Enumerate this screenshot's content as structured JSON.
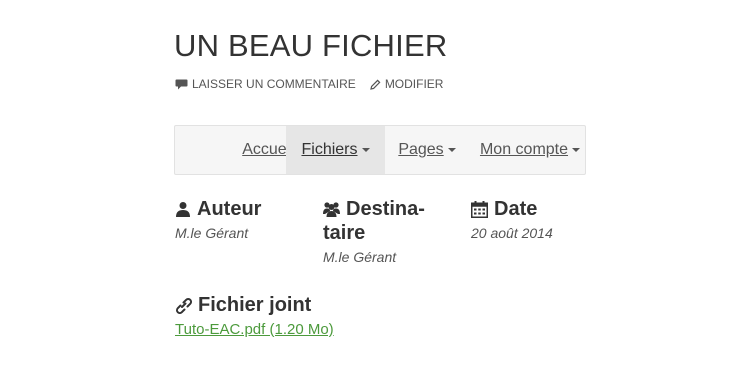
{
  "article": {
    "title": "UN BEAU FICHIER",
    "actions": {
      "comment_label": "LAISSER UN COMMENTAIRE",
      "edit_label": "MODIFIER"
    }
  },
  "nav": {
    "items": [
      {
        "label": "Accueil",
        "dropdown": false,
        "active": false
      },
      {
        "label": "Fichiers",
        "dropdown": true,
        "active": true
      },
      {
        "label": "Pages",
        "dropdown": true,
        "active": false
      },
      {
        "label": "Mon compte",
        "dropdown": true,
        "active": false
      }
    ]
  },
  "details": {
    "author": {
      "label": "Auteur",
      "value": "M.le Gérant",
      "icon": "user-icon"
    },
    "recipient": {
      "label_line1": "Destina-",
      "label_line2": "taire",
      "value": "M.le Gérant",
      "icon": "users-icon"
    },
    "date": {
      "label": "Date",
      "value": "20 août 2014",
      "icon": "calendar-icon"
    },
    "attachment": {
      "label": "Fichier joint",
      "link": "Tuto-EAC.pdf (1.20 Mo)",
      "icon": "paperclip-icon"
    }
  },
  "colors": {
    "link_green": "#4c9a3c",
    "nav_active_bg": "#e6e6e6",
    "nav_bg": "#f6f6f6"
  }
}
